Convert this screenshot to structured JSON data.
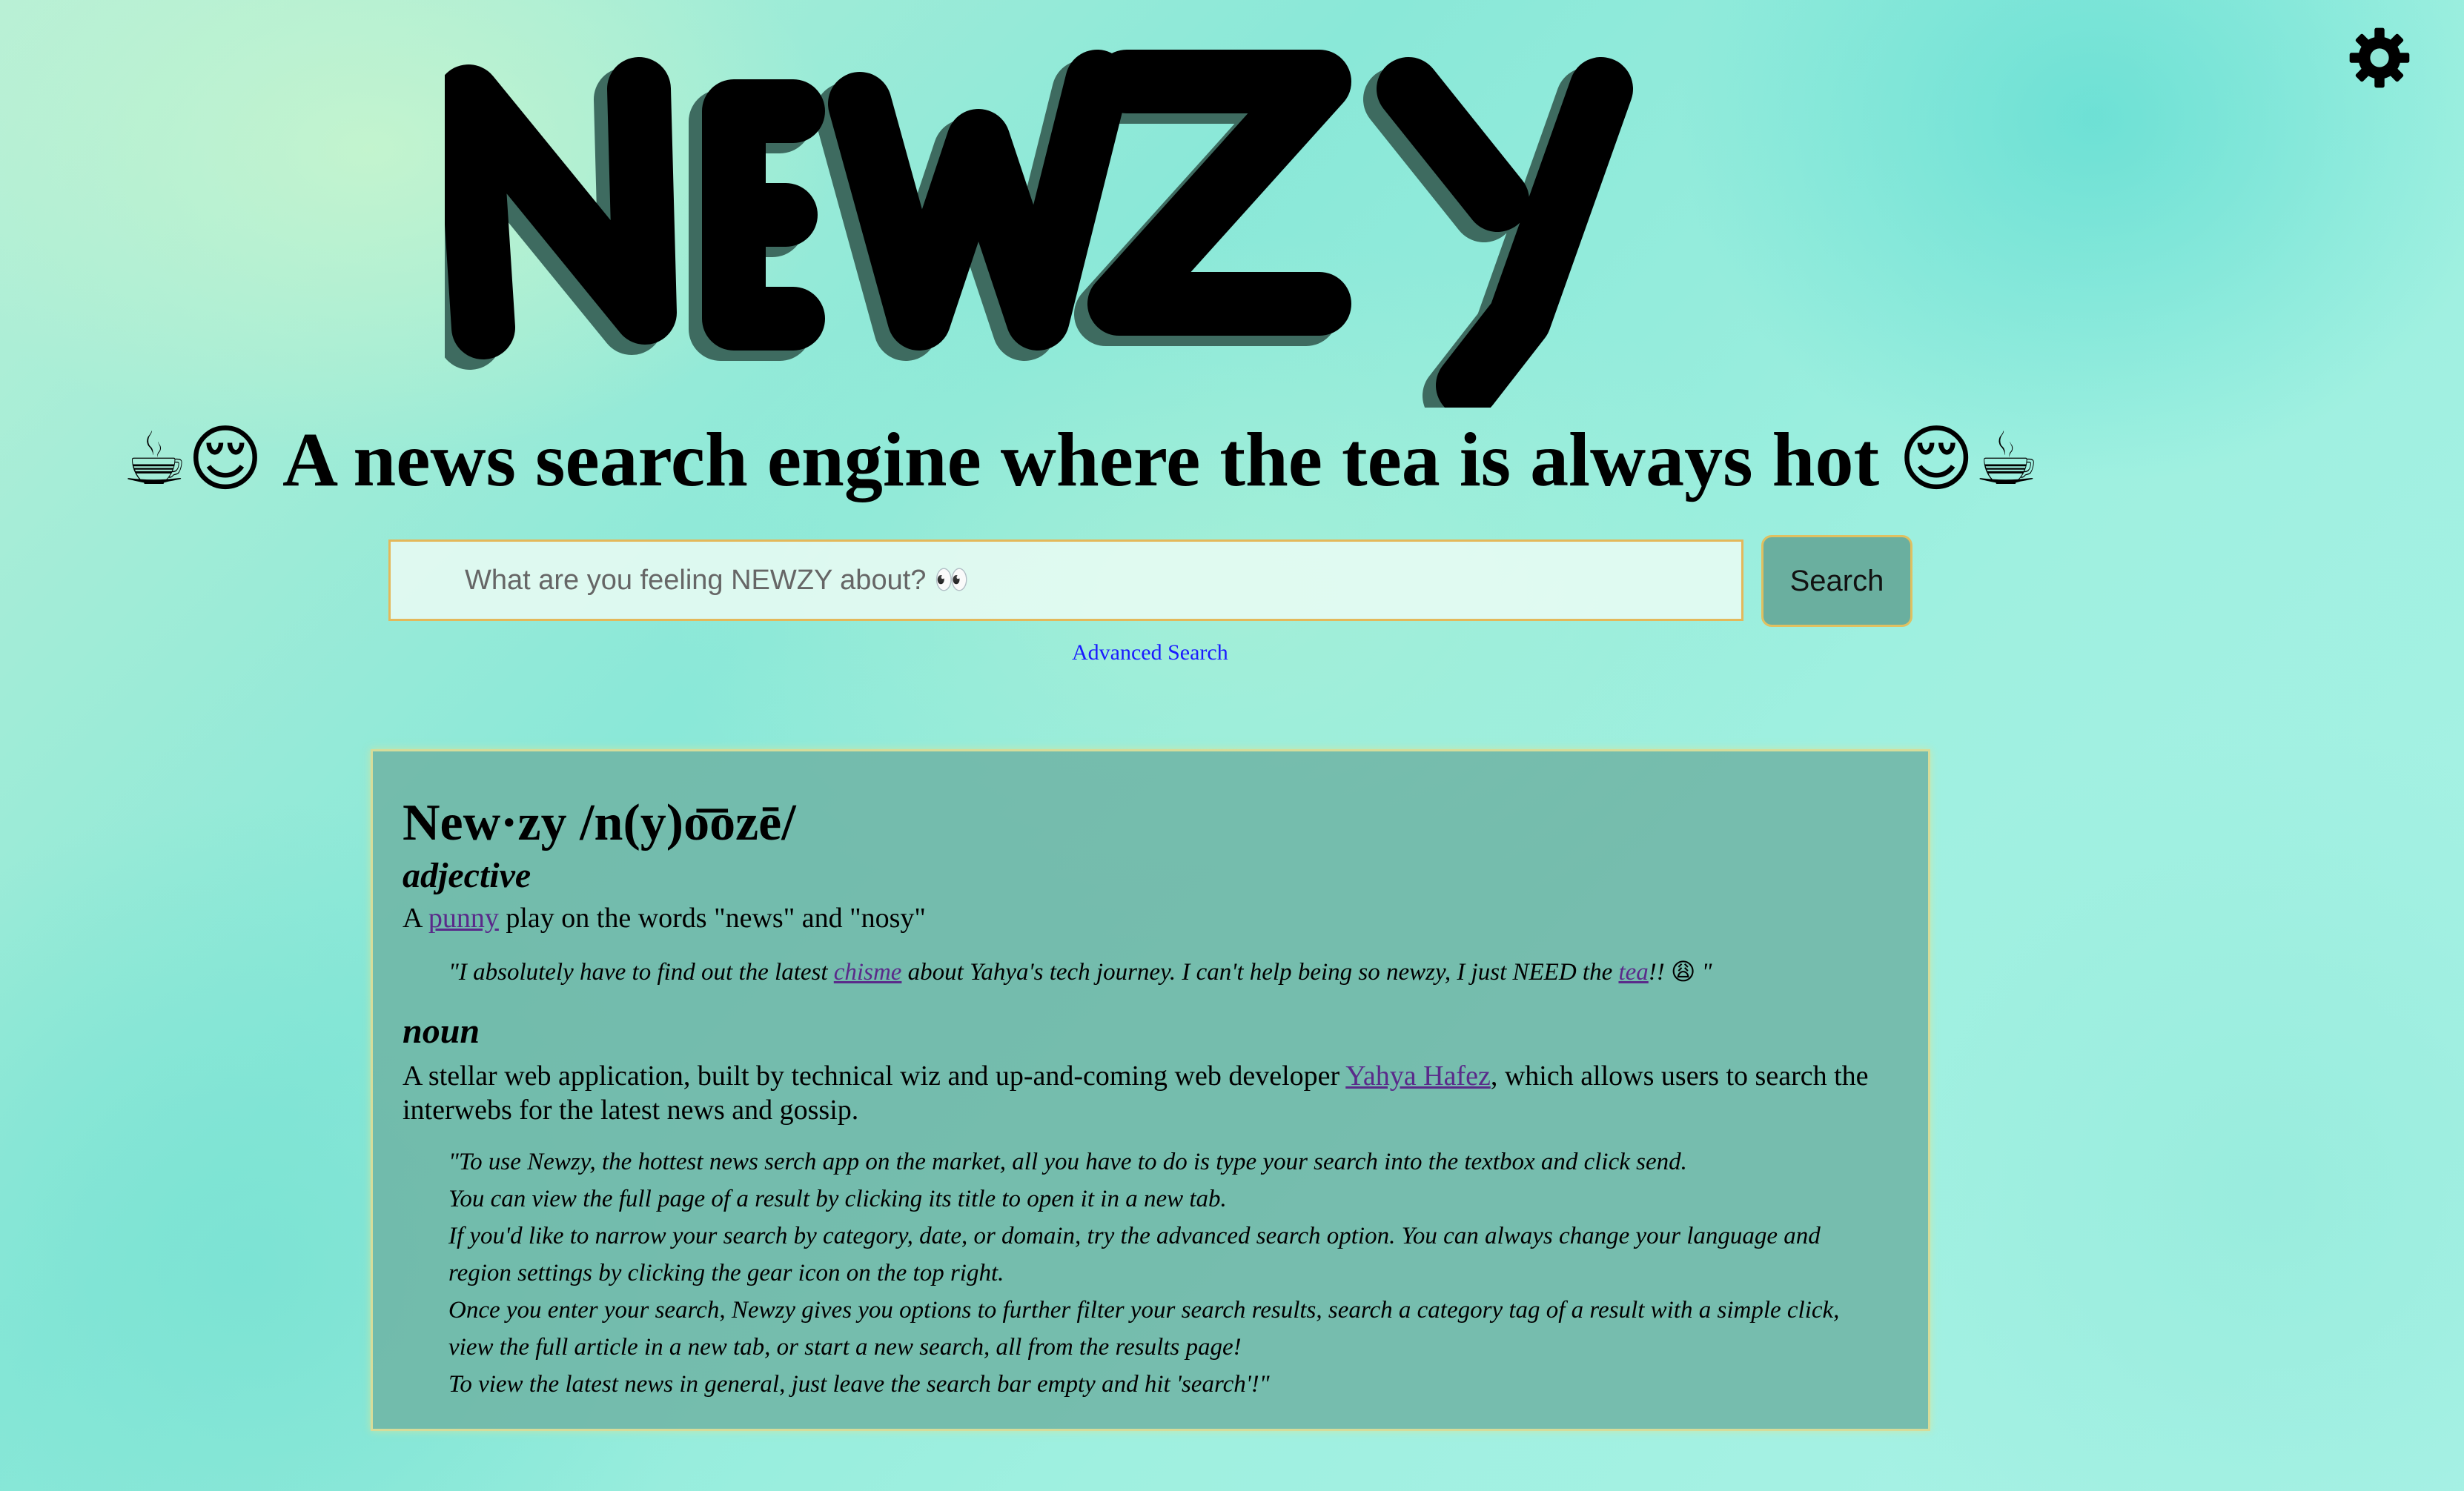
{
  "header": {
    "logo_text": "NEWZY",
    "settings_icon": "gear-icon"
  },
  "tagline": {
    "text": "A news search engine where the tea is always hot",
    "left_emojis": "☕😌",
    "right_emojis": "😌☕"
  },
  "search": {
    "placeholder": "What are you feeling NEWZY about? 👀",
    "value": "",
    "button_label": "Search",
    "advanced_link": "Advanced Search"
  },
  "definition": {
    "headword": "New·zy  /n(y)o͞ozē/",
    "adjective": {
      "pos": "adjective",
      "def_prefix": "A ",
      "def_link": "punny",
      "def_suffix": " play on the words \"news\" and \"nosy\"",
      "quote_part1": "\"I absolutely have to find out the latest ",
      "quote_link1": "chisme",
      "quote_part2": " about Yahya's tech journey. I can't help being so newzy, I just NEED the ",
      "quote_link2": "tea",
      "quote_part3": "!! ",
      "quote_emoji": "😩",
      "quote_end": " \""
    },
    "noun": {
      "pos": "noun",
      "def_prefix": "A stellar web application, built by technical wiz and up-and-coming web developer ",
      "def_link": "Yahya Hafez",
      "def_suffix": ", which allows users to search the interwebs for the latest news and gossip.",
      "quote_lines": [
        "\"To use Newzy, the hottest news serch app on the market, all you have to do is type your search into the textbox and click send.",
        "You can view the full page of a result by clicking its title to open it in a new tab.",
        "If you'd like to narrow your search by category, date, or domain, try the advanced search option. You can always change your language and",
        "region settings by clicking the gear icon on the top right.",
        "Once you enter your search, Newzy gives you options to further filter your search results, search a category tag of a result with a simple click,",
        "view the full article in a new tab, or start a new search, all from the results page!",
        "To view the latest news in general, just leave the search bar empty and hit 'search'!\""
      ]
    }
  },
  "colors": {
    "card_bg": "#6eb4a5",
    "button_bg": "#6aaf9f",
    "input_border": "#e4b85a",
    "link_visited": "#5a2a8a",
    "advanced_link": "#1a1aff"
  }
}
